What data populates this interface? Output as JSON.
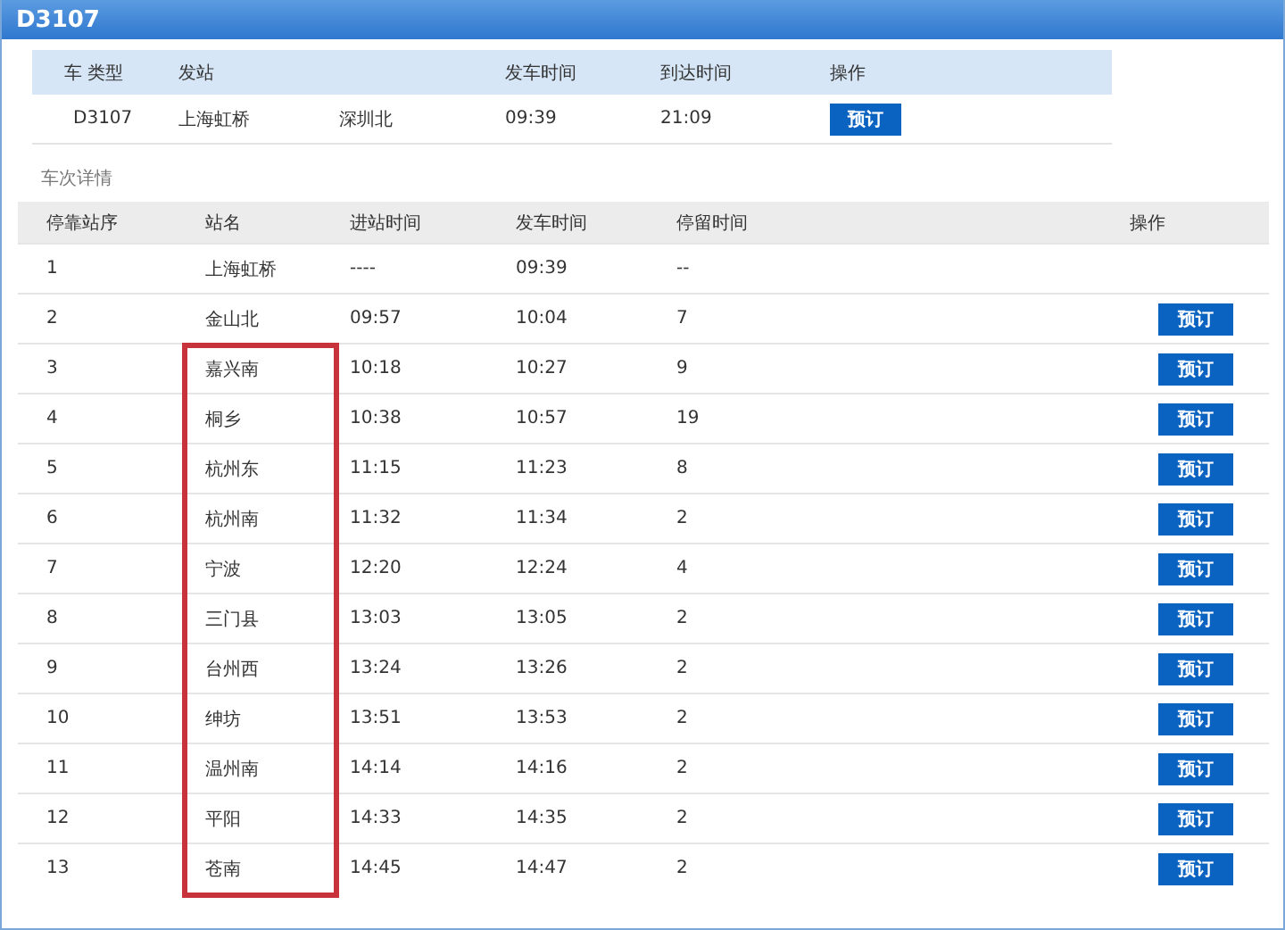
{
  "window": {
    "title": "D3107"
  },
  "summary": {
    "columns": [
      "车  类型",
      "发站",
      "",
      "发车时间",
      "到达时间",
      "操作"
    ],
    "row": {
      "train": "D3107",
      "from": "上海虹桥",
      "to": "深圳北",
      "depart": "09:39",
      "arrive": "21:09",
      "button": "预订"
    }
  },
  "details_label": "车次详情",
  "stops": {
    "columns": [
      "停靠站序",
      "站名",
      "进站时间",
      "发车时间",
      "停留时间",
      "操作"
    ],
    "rows": [
      {
        "seq": "1",
        "station": "上海虹桥",
        "arrive": "----",
        "depart": "09:39",
        "stay": "--",
        "highlighted": false
      },
      {
        "seq": "2",
        "station": "金山北",
        "arrive": "09:57",
        "depart": "10:04",
        "stay": "7",
        "button": "预订",
        "highlighted": false
      },
      {
        "seq": "3",
        "station": "嘉兴南",
        "arrive": "10:18",
        "depart": "10:27",
        "stay": "9",
        "button": "预订",
        "highlighted": true
      },
      {
        "seq": "4",
        "station": "桐乡",
        "arrive": "10:38",
        "depart": "10:57",
        "stay": "19",
        "button": "预订",
        "highlighted": true
      },
      {
        "seq": "5",
        "station": "杭州东",
        "arrive": "11:15",
        "depart": "11:23",
        "stay": "8",
        "button": "预订",
        "highlighted": true
      },
      {
        "seq": "6",
        "station": "杭州南",
        "arrive": "11:32",
        "depart": "11:34",
        "stay": "2",
        "button": "预订",
        "highlighted": true
      },
      {
        "seq": "7",
        "station": "宁波",
        "arrive": "12:20",
        "depart": "12:24",
        "stay": "4",
        "button": "预订",
        "highlighted": true
      },
      {
        "seq": "8",
        "station": "三门县",
        "arrive": "13:03",
        "depart": "13:05",
        "stay": "2",
        "button": "预订",
        "highlighted": true
      },
      {
        "seq": "9",
        "station": "台州西",
        "arrive": "13:24",
        "depart": "13:26",
        "stay": "2",
        "button": "预订",
        "highlighted": true
      },
      {
        "seq": "10",
        "station": "绅坊",
        "arrive": "13:51",
        "depart": "13:53",
        "stay": "2",
        "button": "预订",
        "highlighted": true
      },
      {
        "seq": "11",
        "station": "温州南",
        "arrive": "14:14",
        "depart": "14:16",
        "stay": "2",
        "button": "预订",
        "highlighted": true
      },
      {
        "seq": "12",
        "station": "平阳",
        "arrive": "14:33",
        "depart": "14:35",
        "stay": "2",
        "button": "预订",
        "highlighted": true
      },
      {
        "seq": "13",
        "station": "苍南",
        "arrive": "14:45",
        "depart": "14:47",
        "stay": "2",
        "button": "预订",
        "highlighted": true
      }
    ]
  }
}
